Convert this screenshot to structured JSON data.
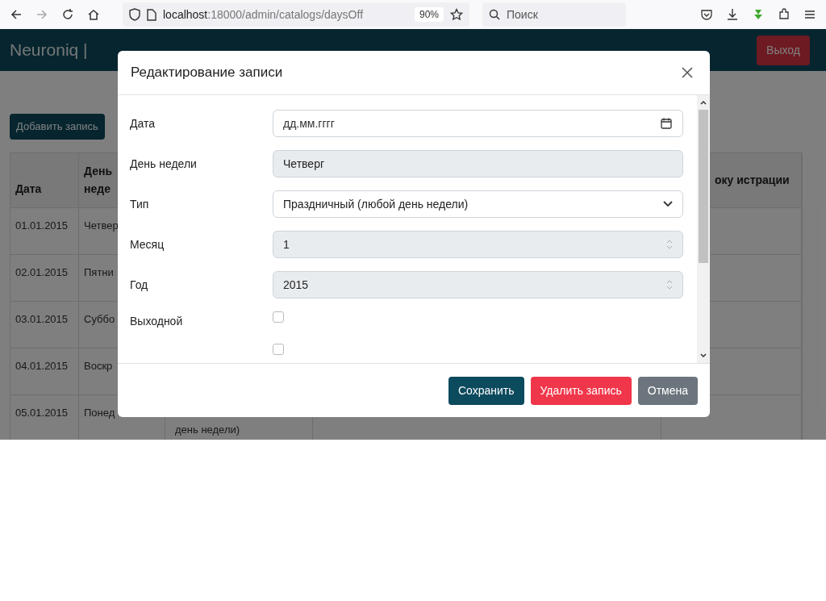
{
  "browser": {
    "url_host": "localhost",
    "url_rest": ":18000/admin/catalogs/daysOff",
    "zoom": "90%",
    "search_placeholder": "Поиск"
  },
  "app": {
    "title": "Neuroniq |",
    "logout": "Выход",
    "add_button": "Добавить запись"
  },
  "table": {
    "header_date": "Дата",
    "header_weekday": "День неде",
    "header_last": "оку истрации",
    "rows": [
      {
        "date": "01.01.2015",
        "weekday": "Четвер"
      },
      {
        "date": "02.01.2015",
        "weekday": "Пятни"
      },
      {
        "date": "03.01.2015",
        "weekday": "Суббо"
      },
      {
        "date": "04.01.2015",
        "weekday": "Воскр"
      },
      {
        "date": "05.01.2015",
        "weekday": "Понед",
        "type_tail": "день недели)"
      }
    ]
  },
  "modal": {
    "title": "Редактирование записи",
    "fields": [
      {
        "kind": "date",
        "label": "Дата",
        "placeholder": "дд.мм.гггг"
      },
      {
        "kind": "readonly",
        "label": "День недели",
        "value": "Четверг"
      },
      {
        "kind": "select",
        "label": "Тип",
        "value": "Праздничный (любой день недели)"
      },
      {
        "kind": "number",
        "label": "Месяц",
        "value": "1"
      },
      {
        "kind": "number",
        "label": "Год",
        "value": "2015"
      },
      {
        "kind": "checkbox",
        "label": "Выходной",
        "checked": false
      },
      {
        "kind": "checkbox",
        "checked": false
      }
    ],
    "buttons": [
      {
        "kind": "primary",
        "label": "Сохранить"
      },
      {
        "kind": "danger",
        "label": "Удалить запись"
      },
      {
        "kind": "secondary",
        "label": "Отмена"
      }
    ]
  }
}
